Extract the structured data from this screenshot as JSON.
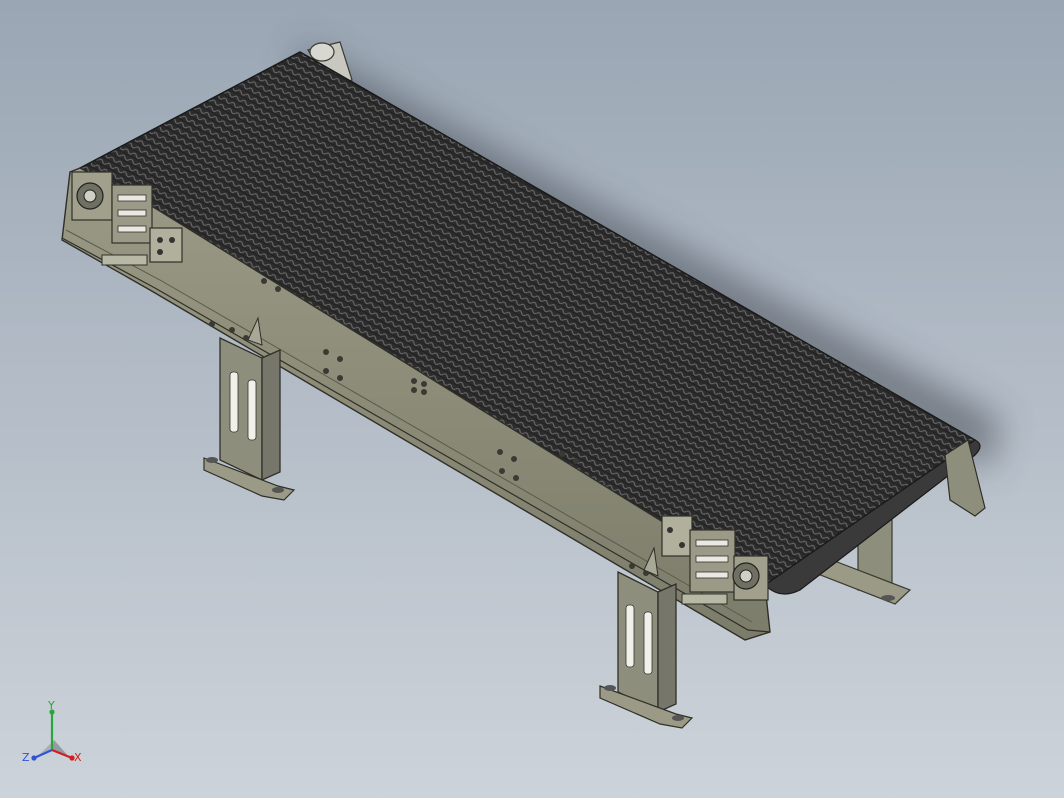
{
  "viewport": {
    "background_top": "#9aa6b4",
    "background_bottom": "#cdd3da"
  },
  "model": {
    "belt_color": "#2f2f2f",
    "frame_color": "#8b8b78",
    "leg_color": "#8e8e7c"
  },
  "triad": {
    "x_label": "X",
    "y_label": "Y",
    "z_label": "Z",
    "x_color": "#d21e1e",
    "y_color": "#27a63a",
    "z_color": "#2f55d4"
  }
}
